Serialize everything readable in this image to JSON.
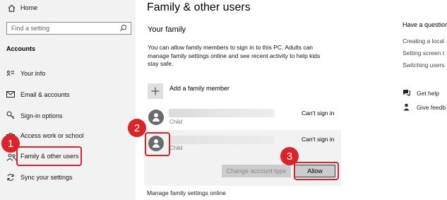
{
  "sidebar": {
    "home_label": "Home",
    "search_placeholder": "Find a setting",
    "section_title": "Accounts",
    "items": [
      {
        "label": "Your info",
        "icon": "person-card-icon"
      },
      {
        "label": "Email & accounts",
        "icon": "mail-icon"
      },
      {
        "label": "Sign-in options",
        "icon": "key-icon"
      },
      {
        "label": "Access work or school",
        "icon": "briefcase-icon"
      },
      {
        "label": "Family & other users",
        "icon": "people-icon",
        "selected": true
      },
      {
        "label": "Sync your settings",
        "icon": "sync-icon"
      }
    ]
  },
  "main": {
    "page_title": "Family & other users",
    "section_title": "Your family",
    "description_lines": [
      "You can allow family members to sign in to this PC. Adults can",
      "manage family settings online and see recent activity to help kids",
      "stay safe."
    ],
    "add_member_label": "Add a family member",
    "members": [
      {
        "role": "Child",
        "status": "Can't sign in"
      },
      {
        "role": "Child",
        "status": "Can't sign in"
      }
    ],
    "change_account_type_label": "Change account type",
    "allow_label": "Allow",
    "manage_link": "Manage family settings online"
  },
  "aside": {
    "title": "Have a question",
    "links": [
      "Creating a local",
      "Setting screen t",
      "Switching users"
    ],
    "get_help": "Get help",
    "give_feedback": "Give feedb"
  },
  "callouts": [
    "1",
    "2",
    "3"
  ],
  "colors": {
    "callout_red": "#d9252a",
    "sidebar_bg": "#f2f2f2",
    "selected_row_bg": "#f2f2f2",
    "allow_btn_bg": "#cccccc",
    "change_btn_bg": "#cccccc"
  }
}
